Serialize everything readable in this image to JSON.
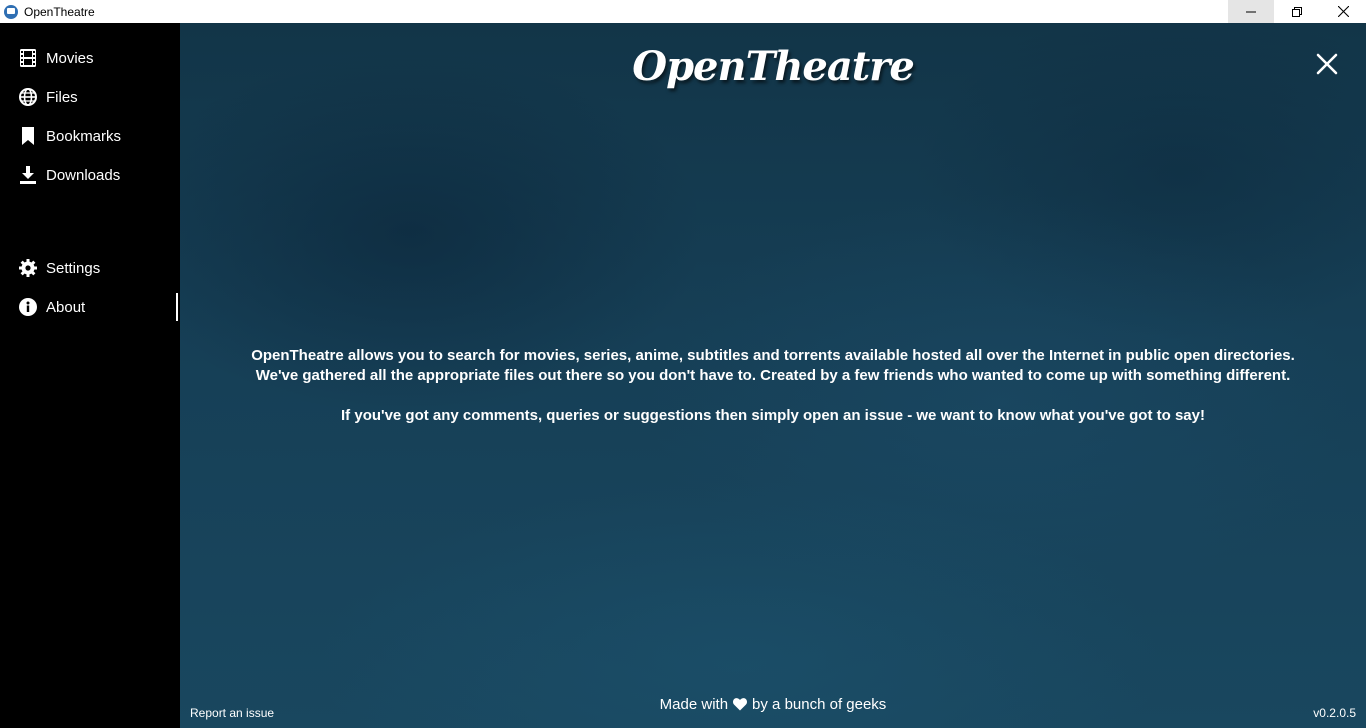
{
  "window": {
    "title": "OpenTheatre",
    "controls": [
      "minimize",
      "restore",
      "close"
    ]
  },
  "sidebar": {
    "items": [
      {
        "label": "Movies",
        "icon": "film-icon"
      },
      {
        "label": "Files",
        "icon": "globe-icon"
      },
      {
        "label": "Bookmarks",
        "icon": "bookmark-icon"
      },
      {
        "label": "Downloads",
        "icon": "download-icon"
      },
      {
        "label": "Settings",
        "icon": "gear-icon"
      },
      {
        "label": "About",
        "icon": "info-icon",
        "active": true
      }
    ]
  },
  "main": {
    "logo": "OpenTheatre",
    "close_icon": "close-icon",
    "about": {
      "line1": "OpenTheatre allows you to search for movies, series, anime, subtitles and torrents available hosted all over the Internet in public open directories.",
      "line2": "We've gathered all the appropriate files out there so you don't have to. Created by a few friends who wanted to come up with something different.",
      "line3": "If you've got any comments, queries or suggestions then simply open an issue - we want to know what you've got to say!"
    }
  },
  "footer": {
    "report_link": "Report an issue",
    "made_with_prefix": "Made with",
    "made_with_suffix": "by a bunch of geeks",
    "heart_icon": "heart-icon",
    "version": "v0.2.0.5"
  },
  "colors": {
    "sidebar_bg": "#000000",
    "main_bg": "#163f56",
    "text": "#ffffff"
  }
}
